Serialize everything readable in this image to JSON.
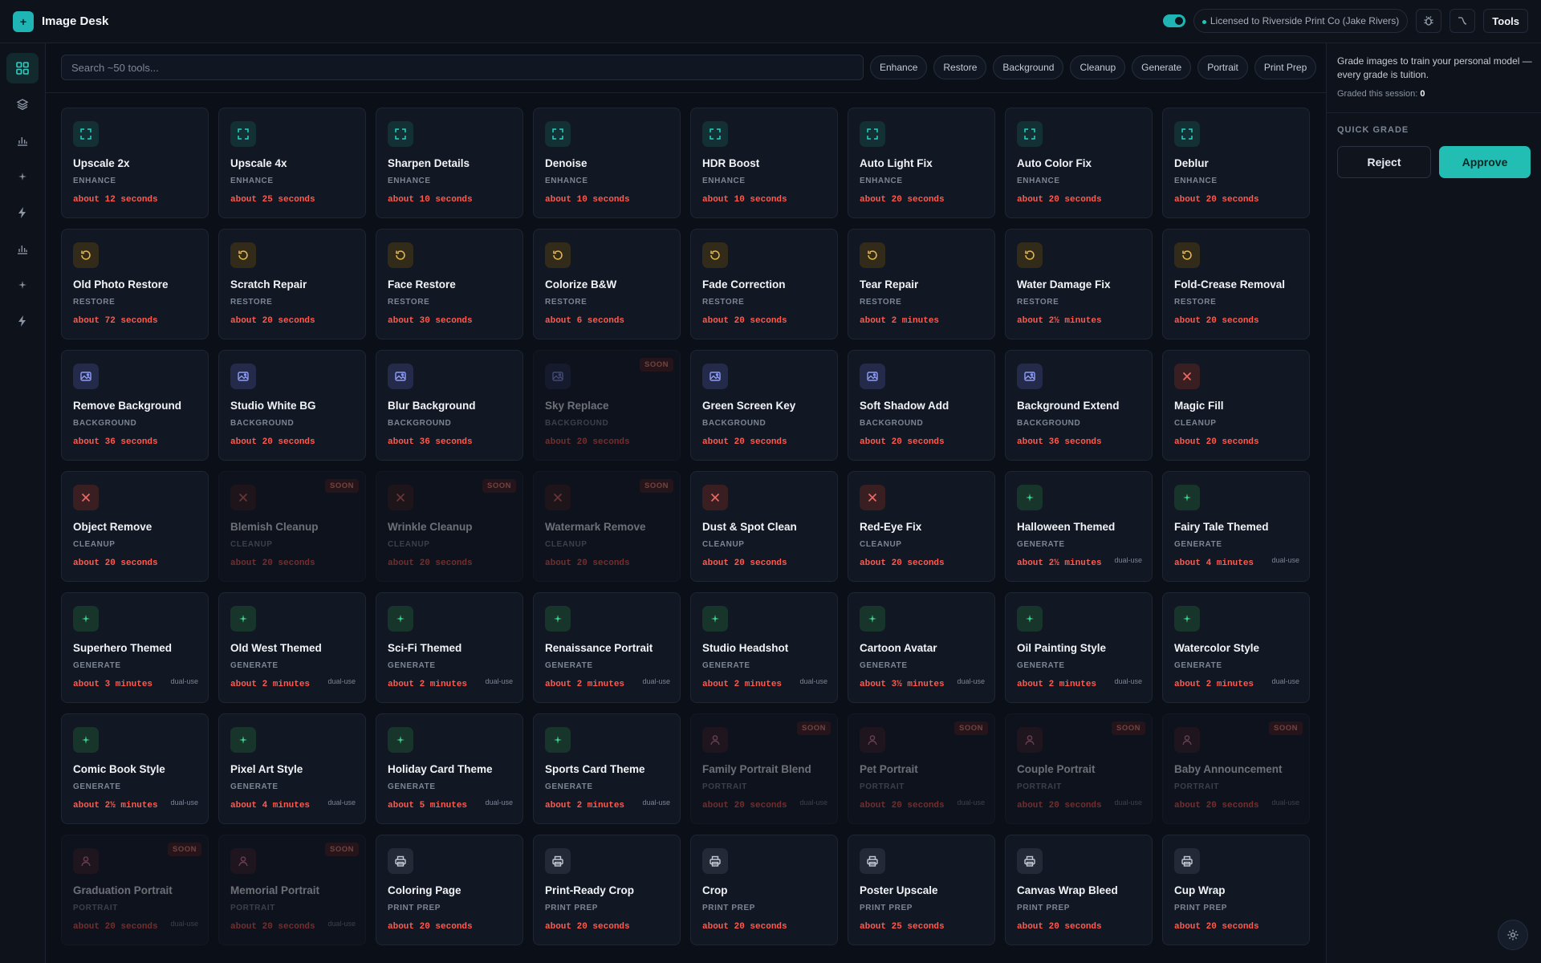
{
  "app": {
    "title": "Image Desk",
    "logo_glyph": "+"
  },
  "header": {
    "license_text": "Licensed to Riverside Print Co (Jake Rivers)",
    "tools_label": "Tools",
    "toggle_on": true
  },
  "search": {
    "placeholder": "Search ~50 tools..."
  },
  "filters": [
    "Enhance",
    "Restore",
    "Background",
    "Cleanup",
    "Generate",
    "Portrait",
    "Print Prep"
  ],
  "panel": {
    "description": "Grade images to train your personal model — every grade is tuition.",
    "session_label": "Graded this session:",
    "session_count": "0",
    "quick_grade_label": "QUICK GRADE",
    "reject_label": "Reject",
    "approve_label": "Approve"
  },
  "colors": {
    "accent": "#22bdb3",
    "time": "#ff5a4e",
    "soon_bg": "#4a1f1f"
  },
  "soon_label": "SOON",
  "dual_label": "dual-use",
  "tools": [
    {
      "name": "Upscale 2x",
      "cat": "ENHANCE",
      "time": "about 12 seconds",
      "icon": "expand-icon",
      "kind": "enhance",
      "soon": false,
      "dual": false
    },
    {
      "name": "Upscale 4x",
      "cat": "ENHANCE",
      "time": "about 25 seconds",
      "icon": "expand-icon",
      "kind": "enhance",
      "soon": false,
      "dual": false
    },
    {
      "name": "Sharpen Details",
      "cat": "ENHANCE",
      "time": "about 10 seconds",
      "icon": "expand-icon",
      "kind": "enhance",
      "soon": false,
      "dual": false
    },
    {
      "name": "Denoise",
      "cat": "ENHANCE",
      "time": "about 10 seconds",
      "icon": "expand-icon",
      "kind": "enhance",
      "soon": false,
      "dual": false
    },
    {
      "name": "HDR Boost",
      "cat": "ENHANCE",
      "time": "about 10 seconds",
      "icon": "expand-icon",
      "kind": "enhance",
      "soon": false,
      "dual": false
    },
    {
      "name": "Auto Light Fix",
      "cat": "ENHANCE",
      "time": "about 20 seconds",
      "icon": "expand-icon",
      "kind": "enhance",
      "soon": false,
      "dual": false
    },
    {
      "name": "Auto Color Fix",
      "cat": "ENHANCE",
      "time": "about 20 seconds",
      "icon": "expand-icon",
      "kind": "enhance",
      "soon": false,
      "dual": false
    },
    {
      "name": "Deblur",
      "cat": "ENHANCE",
      "time": "about 20 seconds",
      "icon": "expand-icon",
      "kind": "enhance",
      "soon": false,
      "dual": false
    },
    {
      "name": "Old Photo Restore",
      "cat": "RESTORE",
      "time": "about 72 seconds",
      "icon": "restore-icon",
      "kind": "restore",
      "soon": false,
      "dual": false
    },
    {
      "name": "Scratch Repair",
      "cat": "RESTORE",
      "time": "about 20 seconds",
      "icon": "restore-icon",
      "kind": "restore",
      "soon": false,
      "dual": false
    },
    {
      "name": "Face Restore",
      "cat": "RESTORE",
      "time": "about 30 seconds",
      "icon": "restore-icon",
      "kind": "restore",
      "soon": false,
      "dual": false
    },
    {
      "name": "Colorize B&W",
      "cat": "RESTORE",
      "time": "about 6 seconds",
      "icon": "restore-icon",
      "kind": "restore",
      "soon": false,
      "dual": false
    },
    {
      "name": "Fade Correction",
      "cat": "RESTORE",
      "time": "about 20 seconds",
      "icon": "restore-icon",
      "kind": "restore",
      "soon": false,
      "dual": false
    },
    {
      "name": "Tear Repair",
      "cat": "RESTORE",
      "time": "about 2 minutes",
      "icon": "restore-icon",
      "kind": "restore",
      "soon": false,
      "dual": false
    },
    {
      "name": "Water Damage Fix",
      "cat": "RESTORE",
      "time": "about 2½ minutes",
      "icon": "restore-icon",
      "kind": "restore",
      "soon": false,
      "dual": false
    },
    {
      "name": "Fold-Crease Removal",
      "cat": "RESTORE",
      "time": "about 20 seconds",
      "icon": "restore-icon",
      "kind": "restore",
      "soon": false,
      "dual": false
    },
    {
      "name": "Remove Background",
      "cat": "BACKGROUND",
      "time": "about 36 seconds",
      "icon": "image-icon",
      "kind": "background",
      "soon": false,
      "dual": false
    },
    {
      "name": "Studio White BG",
      "cat": "BACKGROUND",
      "time": "about 20 seconds",
      "icon": "image-icon",
      "kind": "background",
      "soon": false,
      "dual": false
    },
    {
      "name": "Blur Background",
      "cat": "BACKGROUND",
      "time": "about 36 seconds",
      "icon": "image-icon",
      "kind": "background",
      "soon": false,
      "dual": false
    },
    {
      "name": "Sky Replace",
      "cat": "BACKGROUND",
      "time": "about 20 seconds",
      "icon": "image-icon",
      "kind": "background",
      "soon": true,
      "dual": false
    },
    {
      "name": "Green Screen Key",
      "cat": "BACKGROUND",
      "time": "about 20 seconds",
      "icon": "image-icon",
      "kind": "background",
      "soon": false,
      "dual": false
    },
    {
      "name": "Soft Shadow Add",
      "cat": "BACKGROUND",
      "time": "about 20 seconds",
      "icon": "image-icon",
      "kind": "background",
      "soon": false,
      "dual": false
    },
    {
      "name": "Background Extend",
      "cat": "BACKGROUND",
      "time": "about 36 seconds",
      "icon": "image-icon",
      "kind": "background",
      "soon": false,
      "dual": false
    },
    {
      "name": "Magic Fill",
      "cat": "CLEANUP",
      "time": "about 20 seconds",
      "icon": "x-icon",
      "kind": "cleanup",
      "soon": false,
      "dual": false
    },
    {
      "name": "Object Remove",
      "cat": "CLEANUP",
      "time": "about 20 seconds",
      "icon": "x-icon",
      "kind": "cleanup",
      "soon": false,
      "dual": false
    },
    {
      "name": "Blemish Cleanup",
      "cat": "CLEANUP",
      "time": "about 20 seconds",
      "icon": "x-icon",
      "kind": "cleanup",
      "soon": true,
      "dual": false
    },
    {
      "name": "Wrinkle Cleanup",
      "cat": "CLEANUP",
      "time": "about 20 seconds",
      "icon": "x-icon",
      "kind": "cleanup",
      "soon": true,
      "dual": false
    },
    {
      "name": "Watermark Remove",
      "cat": "CLEANUP",
      "time": "about 20 seconds",
      "icon": "x-icon",
      "kind": "cleanup",
      "soon": true,
      "dual": false
    },
    {
      "name": "Dust & Spot Clean",
      "cat": "CLEANUP",
      "time": "about 20 seconds",
      "icon": "x-icon",
      "kind": "cleanup",
      "soon": false,
      "dual": false
    },
    {
      "name": "Red-Eye Fix",
      "cat": "CLEANUP",
      "time": "about 20 seconds",
      "icon": "x-icon",
      "kind": "cleanup",
      "soon": false,
      "dual": false
    },
    {
      "name": "Halloween Themed",
      "cat": "GENERATE",
      "time": "about 2½ minutes",
      "icon": "sparkle-icon",
      "kind": "generate",
      "soon": false,
      "dual": true
    },
    {
      "name": "Fairy Tale Themed",
      "cat": "GENERATE",
      "time": "about 4 minutes",
      "icon": "sparkle-icon",
      "kind": "generate",
      "soon": false,
      "dual": true
    },
    {
      "name": "Superhero Themed",
      "cat": "GENERATE",
      "time": "about 3 minutes",
      "icon": "sparkle-icon",
      "kind": "generate",
      "soon": false,
      "dual": true
    },
    {
      "name": "Old West Themed",
      "cat": "GENERATE",
      "time": "about 2 minutes",
      "icon": "sparkle-icon",
      "kind": "generate",
      "soon": false,
      "dual": true
    },
    {
      "name": "Sci-Fi Themed",
      "cat": "GENERATE",
      "time": "about 2 minutes",
      "icon": "sparkle-icon",
      "kind": "generate",
      "soon": false,
      "dual": true
    },
    {
      "name": "Renaissance Portrait",
      "cat": "GENERATE",
      "time": "about 2 minutes",
      "icon": "sparkle-icon",
      "kind": "generate",
      "soon": false,
      "dual": true
    },
    {
      "name": "Studio Headshot",
      "cat": "GENERATE",
      "time": "about 2 minutes",
      "icon": "sparkle-icon",
      "kind": "generate",
      "soon": false,
      "dual": true
    },
    {
      "name": "Cartoon Avatar",
      "cat": "GENERATE",
      "time": "about 3½ minutes",
      "icon": "sparkle-icon",
      "kind": "generate",
      "soon": false,
      "dual": true
    },
    {
      "name": "Oil Painting Style",
      "cat": "GENERATE",
      "time": "about 2 minutes",
      "icon": "sparkle-icon",
      "kind": "generate",
      "soon": false,
      "dual": true
    },
    {
      "name": "Watercolor Style",
      "cat": "GENERATE",
      "time": "about 2 minutes",
      "icon": "sparkle-icon",
      "kind": "generate",
      "soon": false,
      "dual": true
    },
    {
      "name": "Comic Book Style",
      "cat": "GENERATE",
      "time": "about 2½ minutes",
      "icon": "sparkle-icon",
      "kind": "generate",
      "soon": false,
      "dual": true
    },
    {
      "name": "Pixel Art Style",
      "cat": "GENERATE",
      "time": "about 4 minutes",
      "icon": "sparkle-icon",
      "kind": "generate",
      "soon": false,
      "dual": true
    },
    {
      "name": "Holiday Card Theme",
      "cat": "GENERATE",
      "time": "about 5 minutes",
      "icon": "sparkle-icon",
      "kind": "generate",
      "soon": false,
      "dual": true
    },
    {
      "name": "Sports Card Theme",
      "cat": "GENERATE",
      "time": "about 2 minutes",
      "icon": "sparkle-icon",
      "kind": "generate",
      "soon": false,
      "dual": true
    },
    {
      "name": "Family Portrait Blend",
      "cat": "PORTRAIT",
      "time": "about 20 seconds",
      "icon": "person-icon",
      "kind": "portrait",
      "soon": true,
      "dual": true
    },
    {
      "name": "Pet Portrait",
      "cat": "PORTRAIT",
      "time": "about 20 seconds",
      "icon": "person-icon",
      "kind": "portrait",
      "soon": true,
      "dual": true
    },
    {
      "name": "Couple Portrait",
      "cat": "PORTRAIT",
      "time": "about 20 seconds",
      "icon": "person-icon",
      "kind": "portrait",
      "soon": true,
      "dual": true
    },
    {
      "name": "Baby Announcement",
      "cat": "PORTRAIT",
      "time": "about 20 seconds",
      "icon": "person-icon",
      "kind": "portrait",
      "soon": true,
      "dual": true
    },
    {
      "name": "Graduation Portrait",
      "cat": "PORTRAIT",
      "time": "about 20 seconds",
      "icon": "person-icon",
      "kind": "portrait",
      "soon": true,
      "dual": true
    },
    {
      "name": "Memorial Portrait",
      "cat": "PORTRAIT",
      "time": "about 20 seconds",
      "icon": "person-icon",
      "kind": "portrait",
      "soon": true,
      "dual": true
    },
    {
      "name": "Coloring Page",
      "cat": "PRINT PREP",
      "time": "about 20 seconds",
      "icon": "printer-icon",
      "kind": "print",
      "soon": false,
      "dual": false
    },
    {
      "name": "Print-Ready Crop",
      "cat": "PRINT PREP",
      "time": "about 20 seconds",
      "icon": "printer-icon",
      "kind": "print",
      "soon": false,
      "dual": false
    },
    {
      "name": "Crop",
      "cat": "PRINT PREP",
      "time": "about 20 seconds",
      "icon": "printer-icon",
      "kind": "print",
      "soon": false,
      "dual": false
    },
    {
      "name": "Poster Upscale",
      "cat": "PRINT PREP",
      "time": "about 25 seconds",
      "icon": "printer-icon",
      "kind": "print",
      "soon": false,
      "dual": false
    },
    {
      "name": "Canvas Wrap Bleed",
      "cat": "PRINT PREP",
      "time": "about 20 seconds",
      "icon": "printer-icon",
      "kind": "print",
      "soon": false,
      "dual": false
    },
    {
      "name": "Cup Wrap",
      "cat": "PRINT PREP",
      "time": "about 20 seconds",
      "icon": "printer-icon",
      "kind": "print",
      "soon": false,
      "dual": false
    }
  ],
  "nav": [
    {
      "icon": "grid-icon",
      "active": true
    },
    {
      "icon": "layers-icon",
      "active": false
    },
    {
      "icon": "chart-icon",
      "active": false
    },
    {
      "icon": "sparkle-icon",
      "active": false
    },
    {
      "icon": "bolt-icon",
      "active": false
    },
    {
      "icon": "chart-icon",
      "active": false
    },
    {
      "icon": "sparkle-icon",
      "active": false
    },
    {
      "icon": "bolt-icon",
      "active": false
    }
  ]
}
